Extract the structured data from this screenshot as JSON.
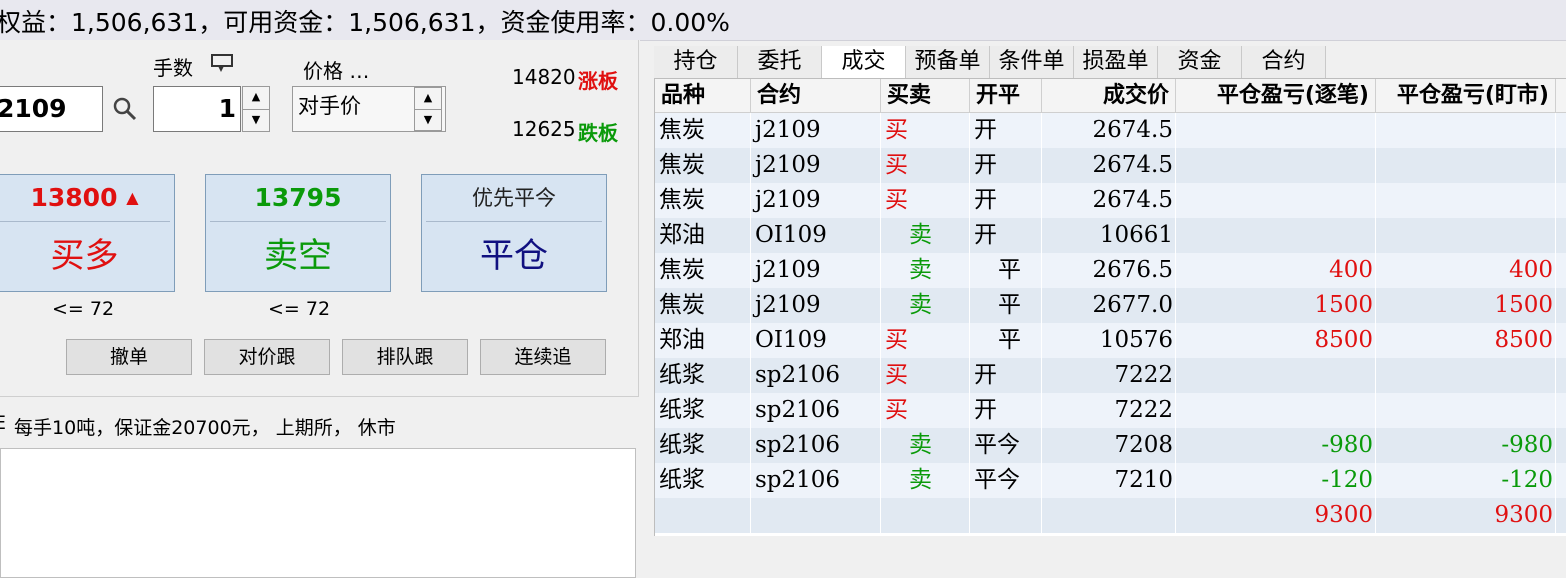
{
  "status_bar": {
    "text": "权益：1,506,631，可用资金：1,506,631，资金使用率：0.00%"
  },
  "order_panel": {
    "contract_value": "2109",
    "qty_label": "手数",
    "qty_value": "1",
    "price_label": "价格 …",
    "price_value": "对手价",
    "limit_up_value": "14820",
    "limit_up_label": "涨板",
    "limit_down_value": "12625",
    "limit_down_label": "跌板",
    "buy": {
      "price": "13800",
      "arrow": "▲",
      "label": "买多",
      "note": "<= 72"
    },
    "sell": {
      "price": "13795",
      "label": "卖空",
      "note": "<= 72"
    },
    "close": {
      "title": "优先平今",
      "label": "平仓"
    },
    "buttons": [
      "撤单",
      "对价跟",
      "排队跟",
      "连续追"
    ],
    "info": "每手10吨，保证金20700元， 上期所， 休市",
    "info_prefix": "E"
  },
  "tabs": [
    "持仓",
    "委托",
    "成交",
    "预备单",
    "条件单",
    "损盈单",
    "资金",
    "合约"
  ],
  "active_tab": 2,
  "table": {
    "headers": [
      "品种",
      "合约",
      "买卖",
      "开平",
      "成交价",
      "平仓盈亏(逐笔)",
      "平仓盈亏(盯市)"
    ],
    "rows": [
      {
        "variety": "焦炭",
        "contract": "j2109",
        "side": "买",
        "offset": "开",
        "price": "2674.5",
        "pnl_trade": "",
        "pnl_mtm": ""
      },
      {
        "variety": "焦炭",
        "contract": "j2109",
        "side": "买",
        "offset": "开",
        "price": "2674.5",
        "pnl_trade": "",
        "pnl_mtm": ""
      },
      {
        "variety": "焦炭",
        "contract": "j2109",
        "side": "买",
        "offset": "开",
        "price": "2674.5",
        "pnl_trade": "",
        "pnl_mtm": ""
      },
      {
        "variety": "郑油",
        "contract": "OI109",
        "side": "卖",
        "offset": "开",
        "price": "10661",
        "pnl_trade": "",
        "pnl_mtm": ""
      },
      {
        "variety": "焦炭",
        "contract": "j2109",
        "side": "卖",
        "offset": "平",
        "price": "2676.5",
        "pnl_trade": "400",
        "pnl_mtm": "400"
      },
      {
        "variety": "焦炭",
        "contract": "j2109",
        "side": "卖",
        "offset": "平",
        "price": "2677.0",
        "pnl_trade": "1500",
        "pnl_mtm": "1500"
      },
      {
        "variety": "郑油",
        "contract": "OI109",
        "side": "买",
        "offset": "平",
        "price": "10576",
        "pnl_trade": "8500",
        "pnl_mtm": "8500"
      },
      {
        "variety": "纸浆",
        "contract": "sp2106",
        "side": "买",
        "offset": "开",
        "price": "7222",
        "pnl_trade": "",
        "pnl_mtm": ""
      },
      {
        "variety": "纸浆",
        "contract": "sp2106",
        "side": "买",
        "offset": "开",
        "price": "7222",
        "pnl_trade": "",
        "pnl_mtm": ""
      },
      {
        "variety": "纸浆",
        "contract": "sp2106",
        "side": "卖",
        "offset": "平今",
        "price": "7208",
        "pnl_trade": "-980",
        "pnl_mtm": "-980"
      },
      {
        "variety": "纸浆",
        "contract": "sp2106",
        "side": "卖",
        "offset": "平今",
        "price": "7210",
        "pnl_trade": "-120",
        "pnl_mtm": "-120"
      },
      {
        "variety": "",
        "contract": "",
        "side": "",
        "offset": "",
        "price": "",
        "pnl_trade": "9300",
        "pnl_mtm": "9300"
      }
    ]
  },
  "colors": {
    "buy": "#e01010",
    "sell": "#0a9a0a",
    "close": "#101080"
  }
}
